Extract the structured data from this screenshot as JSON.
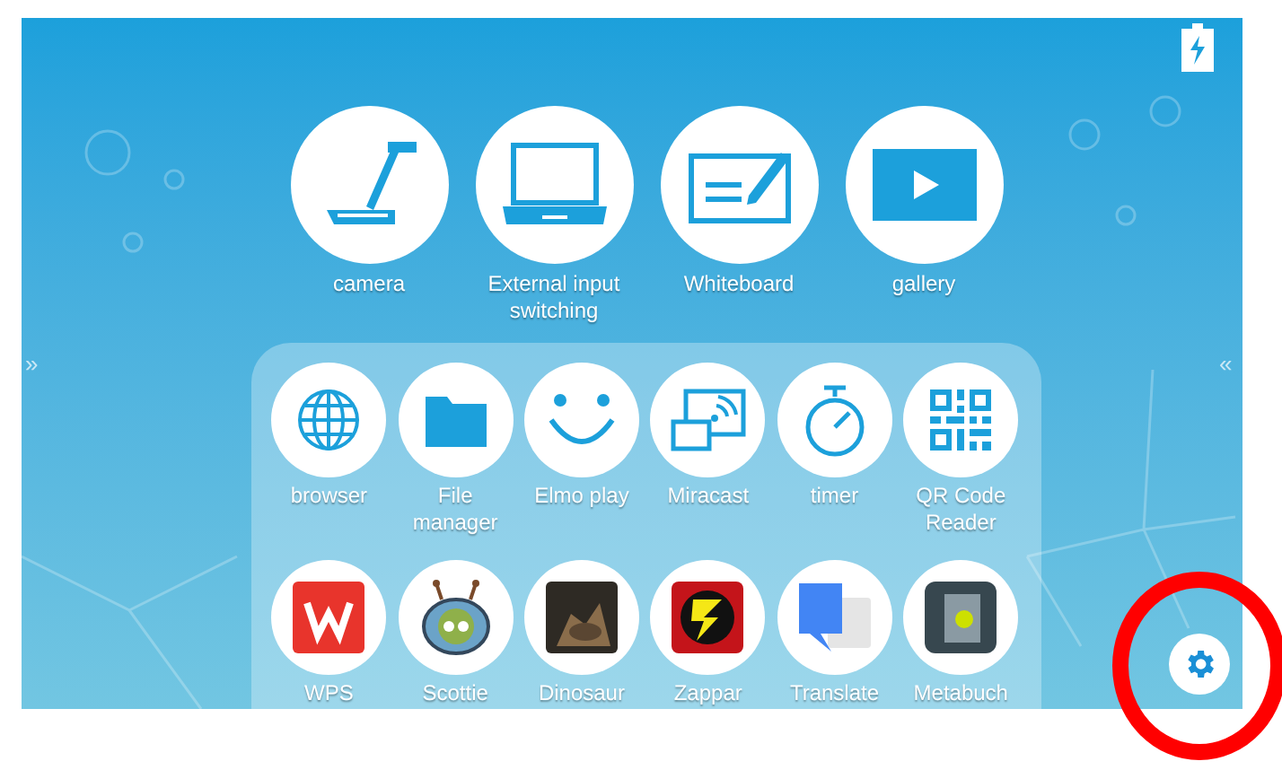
{
  "nav": {
    "left_arrow": "»",
    "right_arrow": "«"
  },
  "main_apps": [
    {
      "label": "camera"
    },
    {
      "label": "External input switching"
    },
    {
      "label": "Whiteboard"
    },
    {
      "label": "gallery"
    }
  ],
  "app_panel": {
    "rows": [
      [
        {
          "label": "browser"
        },
        {
          "label": "File manager"
        },
        {
          "label": "Elmo play"
        },
        {
          "label": "Miracast"
        },
        {
          "label": "timer"
        },
        {
          "label": "QR Code Reader"
        }
      ],
      [
        {
          "label": "WPS"
        },
        {
          "label": "Scottie"
        },
        {
          "label": "Dinosaur"
        },
        {
          "label": "Zappar"
        },
        {
          "label": "Translate"
        },
        {
          "label": "Metabuch"
        }
      ]
    ]
  }
}
